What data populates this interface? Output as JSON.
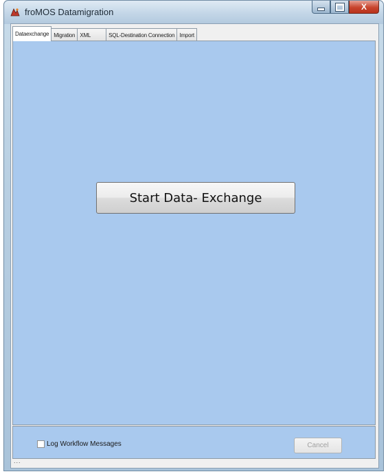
{
  "window": {
    "title": "froMOS Datamigration",
    "caption_close": "X"
  },
  "tabs": [
    {
      "label": "Dataexchange",
      "active": true
    },
    {
      "label": "Migration",
      "active": false
    },
    {
      "label": "XML",
      "active": false
    },
    {
      "label": "SQL-Destination Connection",
      "active": false
    },
    {
      "label": "Import",
      "active": false
    }
  ],
  "main": {
    "start_button_label": "Start Data- Exchange"
  },
  "footer": {
    "log_checkbox_label": "Log Workflow Messages",
    "log_checkbox_checked": false,
    "cancel_label": "Cancel",
    "cancel_enabled": false
  },
  "status": {
    "text": "..."
  },
  "colors": {
    "panel_background": "#a9c9ee",
    "close_button": "#c8442d"
  }
}
